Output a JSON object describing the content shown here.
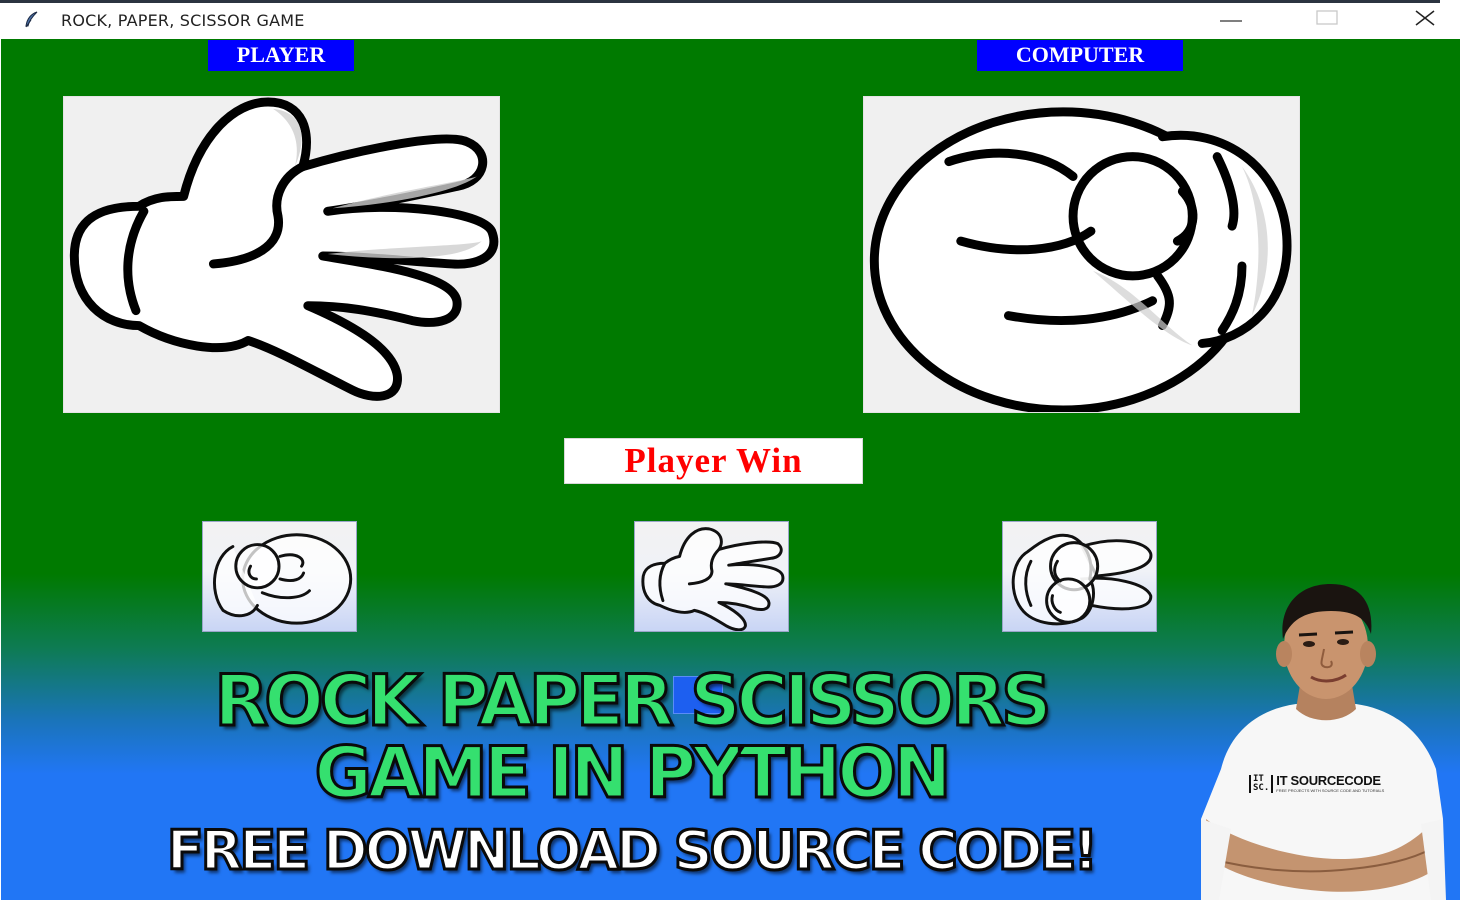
{
  "window": {
    "title": "ROCK, PAPER, SCISSOR GAME",
    "app_icon": "feather-icon",
    "controls": {
      "minimize": "minimize-icon",
      "maximize": "maximize-icon",
      "close": "close-icon"
    }
  },
  "game": {
    "player_label": "PLAYER",
    "computer_label": "COMPUTER",
    "player_choice": "paper",
    "computer_choice": "rock",
    "result_text": "Player Win",
    "choices": [
      {
        "id": "rock",
        "icon": "rock-hand-icon"
      },
      {
        "id": "paper",
        "icon": "paper-hand-icon"
      },
      {
        "id": "scissor",
        "icon": "scissor-hand-icon"
      }
    ]
  },
  "colors": {
    "window_bg": "#007a00",
    "label_bg": "#0000ff",
    "label_text": "#ffffff",
    "result_text": "#ff0000",
    "banner_green": "#35e06f",
    "banner_blue": "#2176f5"
  },
  "banner": {
    "line1": "ROCK PAPER SCISSORS",
    "line2": "GAME IN PYTHON",
    "line3": "FREE DOWNLOAD SOURCE CODE!"
  },
  "presenter": {
    "shirt_logo_mark_top": "IT",
    "shirt_logo_mark_bottom": "SC.",
    "shirt_brand": "IT SOURCECODE",
    "shirt_tagline": "FREE PROJECTS WITH SOURCE CODE AND TUTORIALS"
  }
}
